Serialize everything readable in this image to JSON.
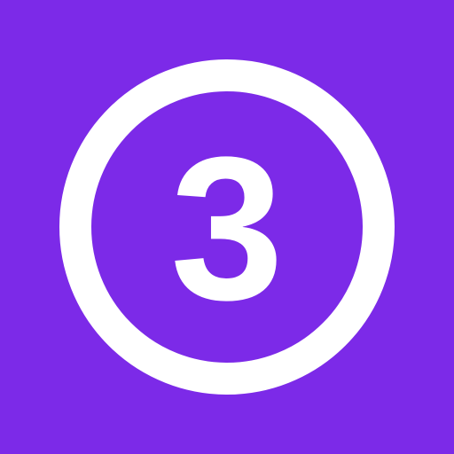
{
  "badge": {
    "numeral": "3",
    "icon": "circled-number-icon",
    "colors": {
      "background": "#7c2ae8",
      "foreground": "#ffffff"
    }
  }
}
